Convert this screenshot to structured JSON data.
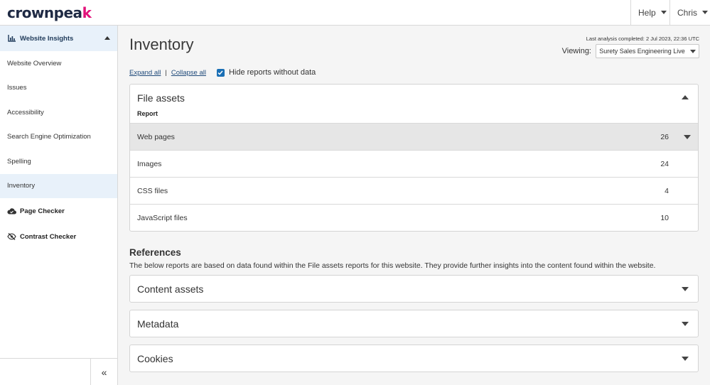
{
  "header": {
    "logo_text_a": "crownpea",
    "logo_text_b": "k",
    "help_label": "Help",
    "user_label": "Chris"
  },
  "sidebar": {
    "section_label": "Website Insights",
    "items": [
      {
        "label": "Website Overview"
      },
      {
        "label": "Issues"
      },
      {
        "label": "Accessibility"
      },
      {
        "label": "Search Engine Optimization"
      },
      {
        "label": "Spelling"
      },
      {
        "label": "Inventory"
      }
    ],
    "tools": [
      {
        "label": "Page Checker",
        "icon": "cloud-check-icon"
      },
      {
        "label": "Contrast Checker",
        "icon": "eye-slash-icon"
      }
    ],
    "collapse_label": "«",
    "active_item": "Inventory"
  },
  "main": {
    "title": "Inventory",
    "last_analysis": "Last analysis completed: 2 Jul 2023, 22:36 UTC",
    "viewing_label": "Viewing:",
    "viewing_value": "Surety Sales Engineering Live",
    "expand_all": "Expand all",
    "separator": "|",
    "collapse_all": "Collapse all",
    "hide_reports_label": "Hide reports without data",
    "hide_reports_checked": true,
    "file_assets": {
      "title": "File assets",
      "column_header": "Report",
      "rows": [
        {
          "label": "Web pages",
          "count": "26"
        },
        {
          "label": "Images",
          "count": "24"
        },
        {
          "label": "CSS files",
          "count": "4"
        },
        {
          "label": "JavaScript files",
          "count": "10"
        }
      ]
    },
    "references": {
      "title": "References",
      "description": "The below reports are based on data found within the File assets reports for this website. They provide further insights into the content found within the website.",
      "panels": [
        {
          "title": "Content assets"
        },
        {
          "title": "Metadata"
        },
        {
          "title": "Cookies"
        }
      ]
    }
  },
  "colors": {
    "brand_dark": "#1f2a44",
    "brand_accent": "#e2127a",
    "active_bg": "#e8f1fa",
    "checkbox": "#1a6fb5"
  }
}
